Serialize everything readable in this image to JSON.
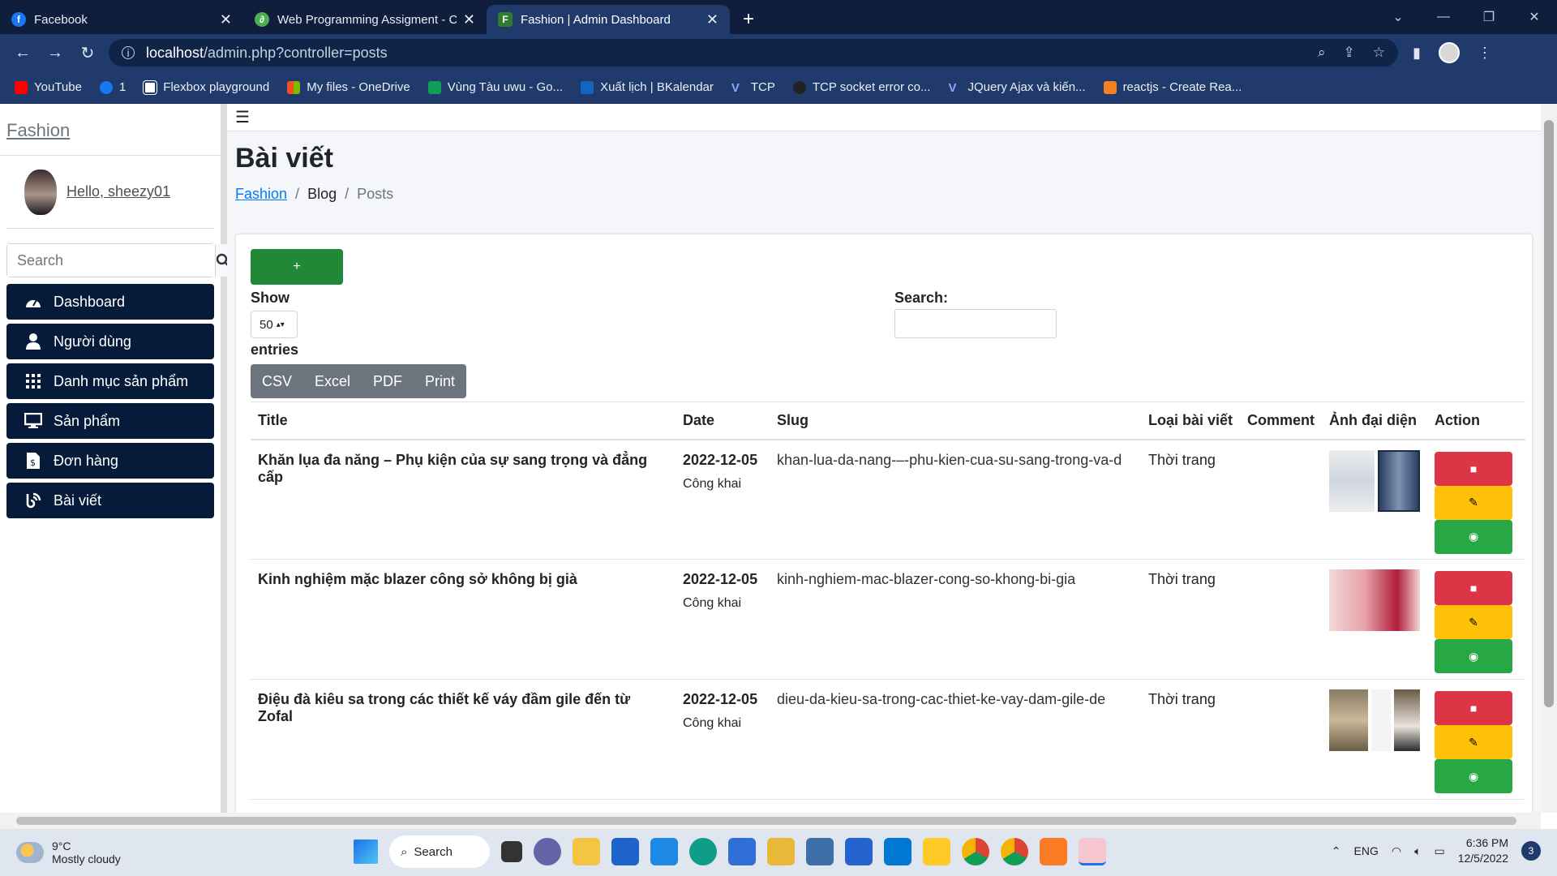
{
  "browser": {
    "tabs": [
      {
        "title": "Facebook",
        "icon": "facebook-icon",
        "color": "#1877f2",
        "active": false
      },
      {
        "title": "Web Programming Assigment - C",
        "icon": "leaf-icon",
        "color": "#4caf50",
        "active": false
      },
      {
        "title": "Fashion | Admin Dashboard",
        "icon": "page-icon",
        "color": "#2e7d32",
        "active": true
      }
    ],
    "url_host": "localhost",
    "url_path": "/admin.php?controller=posts",
    "bookmarks": [
      {
        "label": "YouTube",
        "color": "#ff0000"
      },
      {
        "label": "1",
        "color": "#1877f2"
      },
      {
        "label": "Flexbox playground",
        "color": "#ffffff"
      },
      {
        "label": "My files - OneDrive",
        "color": "#f25022"
      },
      {
        "label": "Vùng Tàu uwu - Go...",
        "color": "#0f9d58"
      },
      {
        "label": "Xuất lịch | BKalendar",
        "color": "#1565c0"
      },
      {
        "label": "TCP",
        "color": "#90a4ff"
      },
      {
        "label": "TCP socket error co...",
        "color": "#222222"
      },
      {
        "label": "JQuery Ajax và kiến...",
        "color": "#90a4ff"
      },
      {
        "label": "reactjs - Create Rea...",
        "color": "#f48024"
      }
    ]
  },
  "sidebar": {
    "brand": "Fashion",
    "greeting": "Hello, sheezy01",
    "search_placeholder": "Search",
    "items": [
      {
        "label": "Dashboard",
        "icon": "gauge-icon"
      },
      {
        "label": "Người dùng",
        "icon": "user-icon"
      },
      {
        "label": "Danh mục sản phẩm",
        "icon": "grid-icon"
      },
      {
        "label": "Sản phẩm",
        "icon": "monitor-icon"
      },
      {
        "label": "Đơn hàng",
        "icon": "invoice-icon"
      },
      {
        "label": "Bài viết",
        "icon": "blog-icon"
      }
    ]
  },
  "main": {
    "title": "Bài viết",
    "breadcrumb": [
      "Fashion",
      "Blog",
      "Posts"
    ],
    "add_label": "+",
    "show_label": "Show",
    "page_size": "50",
    "entries_label": "entries",
    "search_label": "Search:",
    "export_buttons": [
      "CSV",
      "Excel",
      "PDF",
      "Print"
    ],
    "columns": [
      "Title",
      "Date",
      "Slug",
      "Loại bài viết",
      "Comment",
      "Ảnh đại diện",
      "Action"
    ],
    "rows": [
      {
        "title": "Khăn lụa đa năng – Phụ kiện của sự sang trọng và đẳng cấp",
        "date": "2022-12-05",
        "status": "Công khai",
        "slug": "khan-lua-da-nang-–-phu-kien-cua-su-sang-trong-va-d",
        "type": "Thời trang",
        "comment": ""
      },
      {
        "title": "Kinh nghiệm mặc blazer công sở không bị già",
        "date": "2022-12-05",
        "status": "Công khai",
        "slug": "kinh-nghiem-mac-blazer-cong-so-khong-bi-gia",
        "type": "Thời trang",
        "comment": ""
      },
      {
        "title": "Điệu đà kiêu sa trong các thiết kế váy đầm gile đến từ Zofal",
        "date": "2022-12-05",
        "status": "Công khai",
        "slug": "dieu-da-kieu-sa-trong-cac-thiet-ke-vay-dam-gile-de",
        "type": "Thời trang",
        "comment": ""
      }
    ]
  },
  "taskbar": {
    "temperature": "9°C",
    "weather": "Mostly cloudy",
    "search": "Search",
    "lang": "ENG",
    "time": "6:36 PM",
    "date": "12/5/2022",
    "notifications": "3"
  },
  "colors": {
    "sidebar_item_bg": "#061a3a",
    "add_button": "#218838",
    "delete": "#dc3545",
    "edit": "#ffc107",
    "view": "#28a745"
  }
}
